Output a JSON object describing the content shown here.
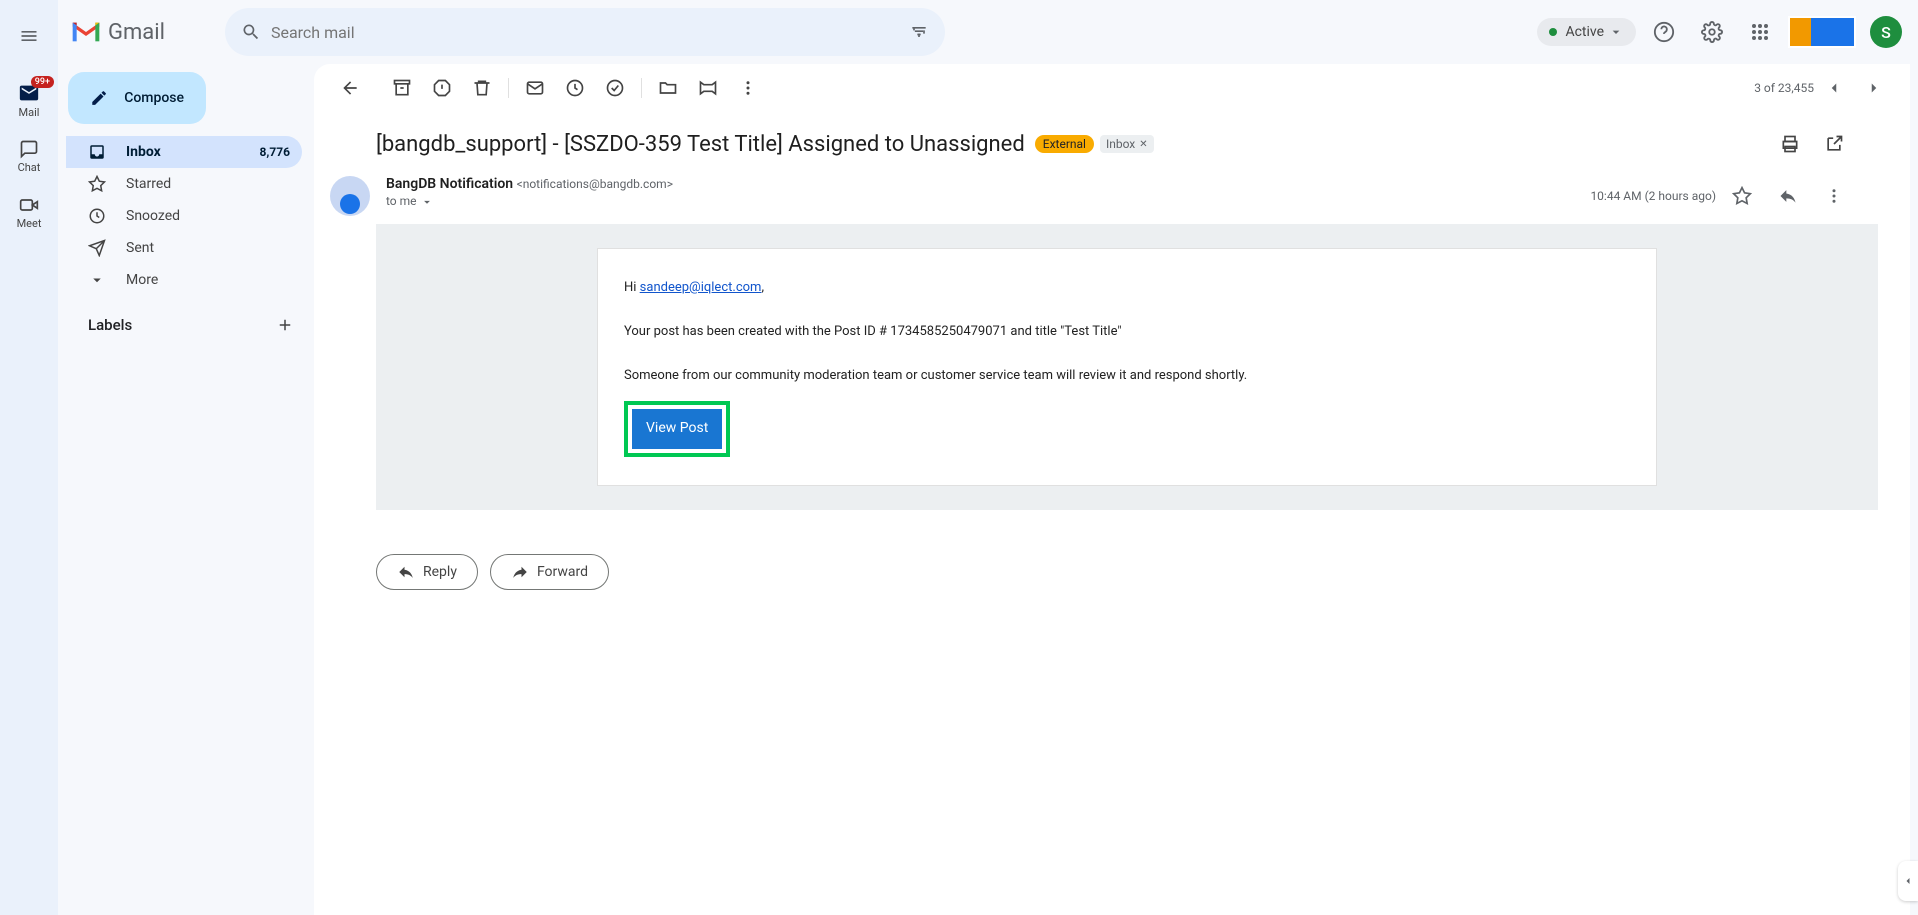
{
  "app": {
    "name": "Gmail"
  },
  "rail": {
    "mail": {
      "label": "Mail",
      "badge": "99+"
    },
    "chat": {
      "label": "Chat"
    },
    "meet": {
      "label": "Meet"
    }
  },
  "search": {
    "placeholder": "Search mail"
  },
  "header": {
    "status": "Active",
    "avatar_letter": "S"
  },
  "compose": {
    "label": "Compose"
  },
  "nav": {
    "inbox": {
      "label": "Inbox",
      "count": "8,776"
    },
    "starred": {
      "label": "Starred"
    },
    "snoozed": {
      "label": "Snoozed"
    },
    "sent": {
      "label": "Sent"
    },
    "more": {
      "label": "More"
    }
  },
  "labels_header": "Labels",
  "pager": {
    "text": "3 of 23,455"
  },
  "subject": "[bangdb_support] - [SSZDO-359 Test Title] Assigned to Unassigned",
  "badges": {
    "external": "External",
    "inbox": "Inbox"
  },
  "sender": {
    "name": "BangDB Notification",
    "email": "<notifications@bangdb.com>",
    "to": "to me",
    "time": "10:44 AM (2 hours ago)"
  },
  "body": {
    "greeting_prefix": "Hi ",
    "greeting_link": "sandeep@iqlect.com",
    "greeting_suffix": ",",
    "line1": "Your post has been created with the Post ID # 1734585250479071 and title \"Test Title\"",
    "line2": "Someone from our community moderation team or customer service team will review it and respond shortly.",
    "cta": "View Post"
  },
  "actions": {
    "reply": "Reply",
    "forward": "Forward"
  }
}
